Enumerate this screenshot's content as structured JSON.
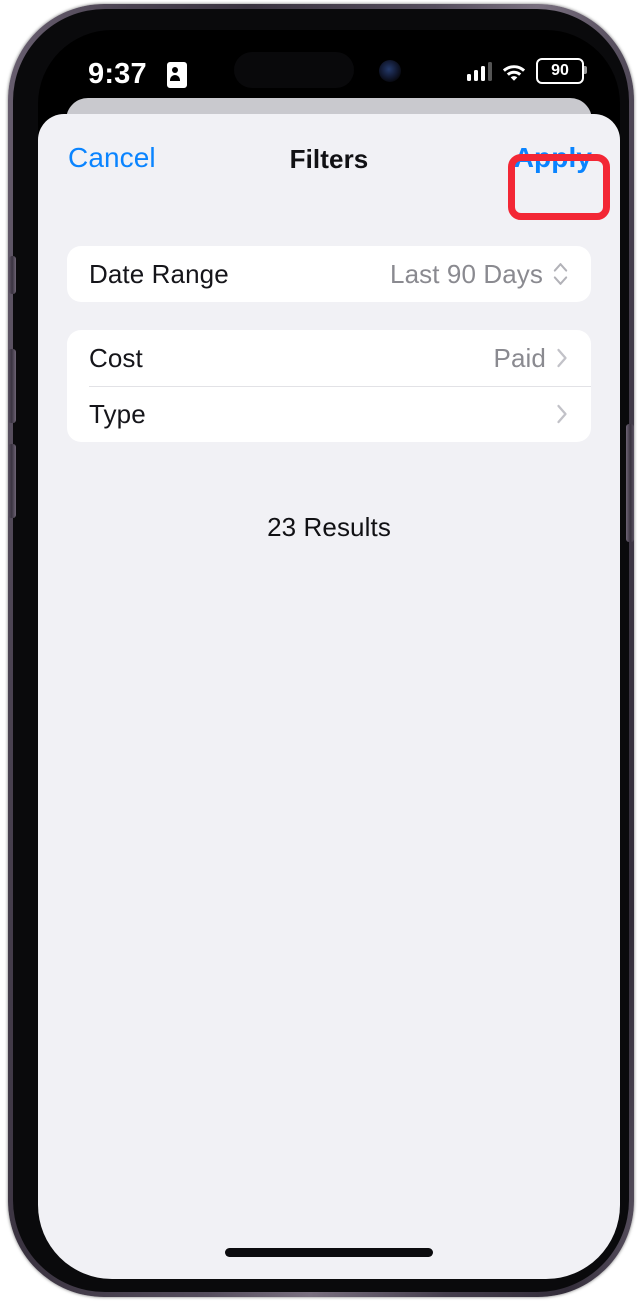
{
  "status_bar": {
    "time": "9:37",
    "lock_icon": "portrait-orientation-lock-icon",
    "signal_icon": "cellular-signal-icon",
    "wifi_icon": "wifi-icon",
    "battery_level": "90"
  },
  "nav": {
    "cancel_label": "Cancel",
    "title": "Filters",
    "apply_label": "Apply"
  },
  "annotation": {
    "type": "red-highlight-rectangle",
    "target": "apply-button",
    "color": "#f32735"
  },
  "date_card": {
    "rows": [
      {
        "label": "Date Range",
        "value": "Last 90 Days",
        "accessory": "chevron-up-down-icon"
      }
    ]
  },
  "filters_card": {
    "rows": [
      {
        "label": "Cost",
        "value": "Paid",
        "accessory": "chevron-right-icon"
      },
      {
        "label": "Type",
        "value": "",
        "accessory": "chevron-right-icon"
      }
    ]
  },
  "results": {
    "text": "23 Results"
  },
  "colors": {
    "accent_blue": "#0a84ff",
    "sheet_background": "#f1f1f5",
    "card_background": "#ffffff",
    "value_gray": "#8a8a90",
    "highlight_red": "#f32735"
  }
}
